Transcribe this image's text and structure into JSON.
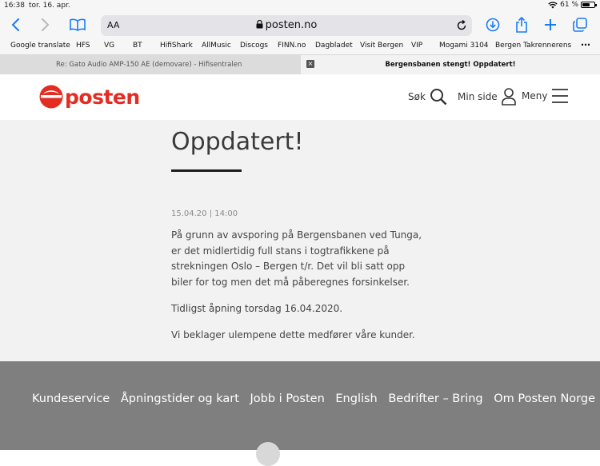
{
  "status_bar": {
    "time": "16:38",
    "date": "tor. 16. apr.",
    "battery": "61 %"
  },
  "toolbar": {
    "text_size_label": "AA",
    "url": "posten.no",
    "icons": [
      "back-icon",
      "forward-icon",
      "bookmarks-icon",
      "lock-icon",
      "reload-icon",
      "download-icon",
      "share-icon",
      "new-tab-icon",
      "tabs-icon"
    ]
  },
  "bookmarks": [
    "Google translate",
    "HFS",
    "VG",
    "BT",
    "HifiShark",
    "AllMusic",
    "Discogs",
    "FINN.no",
    "Dagbladet",
    "Visit Bergen",
    "VIP",
    "Mogami 3104",
    "Bergen Takrennerens"
  ],
  "tabs": [
    {
      "title": "Re: Gato Audio AMP-150 AE (demovare) - Hifisentralen"
    },
    {
      "title": "Bergensbanen stengt! Oppdatert!"
    }
  ],
  "site_header": {
    "logo_text": "posten",
    "search_label": "Søk",
    "account_label": "Min side",
    "menu_label": "Meny"
  },
  "article": {
    "headline_line2": "Oppdatert!",
    "dateline": "15.04.20 | 14:00",
    "paragraphs": [
      "På grunn av avsporing på Bergensbanen ved Tunga, er det midlertidig full stans i togtrafikkene på strekningen Oslo – Bergen t/r.  Det vil bli satt opp biler for tog men det må påberegnes forsinkelser.",
      "Tidligst åpning torsdag 16.04.2020.",
      "Vi beklager ulempene dette medfører våre kunder."
    ]
  },
  "footer": {
    "links": [
      "Kundeservice",
      "Åpningstider og kart",
      "Jobb i Posten",
      "English",
      "Bedrifter – Bring",
      "Om Posten Norge"
    ]
  },
  "colors": {
    "brand_red": "#e32d22",
    "footer_bg": "#7f7f7f",
    "safari_blue": "#1a7cf5"
  }
}
